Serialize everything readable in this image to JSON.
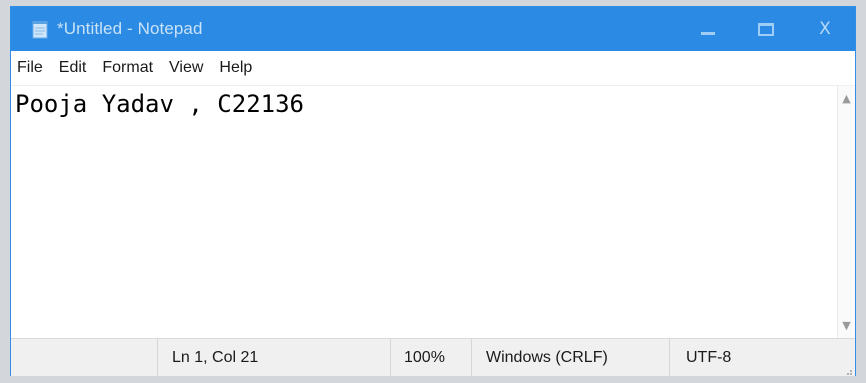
{
  "window": {
    "title": "*Untitled - Notepad",
    "controls": {
      "minimize": "minimize",
      "maximize": "maximize",
      "close": "X"
    }
  },
  "menu": {
    "items": [
      "File",
      "Edit",
      "Format",
      "View",
      "Help"
    ]
  },
  "editor": {
    "content": "Pooja Yadav , C22136"
  },
  "status": {
    "position": "Ln 1, Col 21",
    "zoom": "100%",
    "line_ending": "Windows (CRLF)",
    "encoding": "UTF-8"
  },
  "icons": {
    "app": "notepad-icon",
    "scroll_up": "scroll-up-arrow-icon",
    "scroll_down": "scroll-down-arrow-icon",
    "resize": "resize-grip-icon"
  },
  "colors": {
    "titlebar": "#2b8ae3",
    "title_text": "#c9e2f8",
    "statusbar": "#f0f0f0"
  }
}
